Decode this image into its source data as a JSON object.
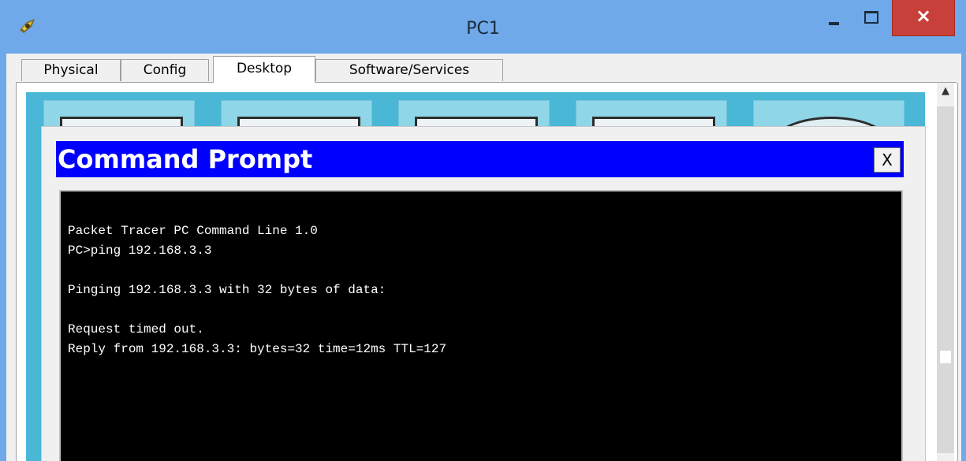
{
  "window": {
    "title": "PC1",
    "app_icon": "packet-tracer-pc-icon",
    "controls": {
      "minimize": "minimize-icon",
      "maximize": "maximize-icon",
      "close": "×"
    }
  },
  "tabs": [
    {
      "label": "Physical",
      "active": false
    },
    {
      "label": "Config",
      "active": false
    },
    {
      "label": "Desktop",
      "active": true
    },
    {
      "label": "Software/Services",
      "active": false
    }
  ],
  "desktop": {
    "icons": [
      "ip-configuration-icon",
      "dial-up-icon",
      "terminal-icon",
      "command-prompt-icon",
      "web-browser-icon"
    ]
  },
  "command_prompt": {
    "title": "Command Prompt",
    "close_label": "X",
    "lines": [
      "Packet Tracer PC Command Line 1.0",
      "PC>ping 192.168.3.3",
      "",
      "Pinging 192.168.3.3 with 32 bytes of data:",
      "",
      "Request timed out.",
      "Reply from 192.168.3.3: bytes=32 time=12ms TTL=127"
    ]
  },
  "colors": {
    "titlebar": "#6fa9ea",
    "close_button": "#c7403a",
    "desktop_background": "#4ab7d6",
    "cmd_header": "#0000ff",
    "terminal_background": "#000000",
    "terminal_text": "#ffffff"
  }
}
